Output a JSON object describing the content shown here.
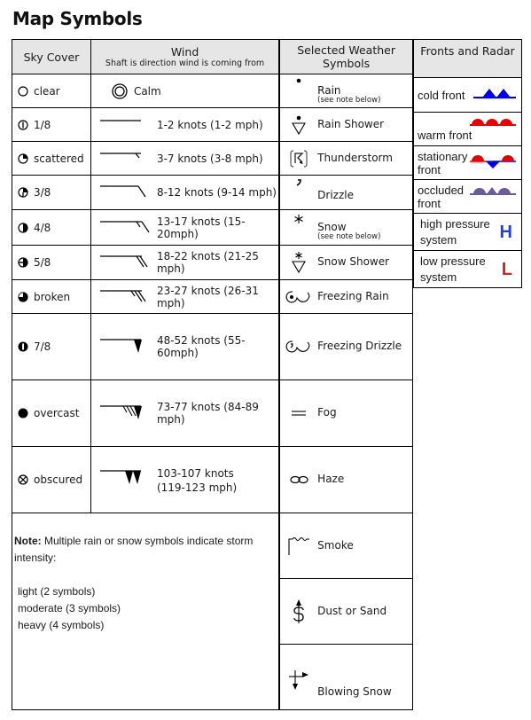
{
  "title": "Map Symbols",
  "main_table": {
    "headers": {
      "sky": "Sky Cover",
      "wind": "Wind",
      "wind_sub": "Shaft is direction wind is coming from",
      "weather": "Selected Weather",
      "weather2": "Symbols"
    },
    "rows": [
      {
        "sky_icon": "clear-circle",
        "sky": "clear",
        "wind_icon": "calm-double-circle",
        "wind": "Calm",
        "wx_icon": "rain-dot",
        "wx": "Rain",
        "wx_sub": "(see note below)"
      },
      {
        "sky_icon": "one-eighth-circle",
        "sky": "1/8",
        "wind_icon": "shaft-no-barb",
        "wind": "1-2 knots (1-2 mph)",
        "wx_icon": "rain-shower",
        "wx": "Rain Shower"
      },
      {
        "sky_icon": "scattered-circle",
        "sky": "scattered",
        "wind_icon": "shaft-half-barb",
        "wind": "3-7 knots (3-8 mph)",
        "wx_icon": "thunderstorm",
        "wx": "Thunderstorm"
      },
      {
        "sky_icon": "three-eighths-circle",
        "sky": "3/8",
        "wind_icon": "shaft-one-barb",
        "wind": "8-12 knots (9-14 mph)",
        "wx_icon": "drizzle-comma",
        "wx": "Drizzle"
      },
      {
        "sky_icon": "half-circle",
        "sky": "4/8",
        "wind_icon": "shaft-one-half-barb",
        "wind": "13-17 knots (15-20mph)",
        "wx_icon": "snow-asterisk",
        "wx": "Snow",
        "wx_sub": "(see note below)"
      },
      {
        "sky_icon": "five-eighths-circle",
        "sky": "5/8",
        "wind_icon": "shaft-two-barbs",
        "wind": "18-22 knots (21-25 mph)",
        "wx_icon": "snow-shower",
        "wx": "Snow Shower"
      },
      {
        "sky_icon": "broken-circle",
        "sky": "broken",
        "wind_icon": "shaft-two-half-barbs",
        "wind": "23-27 knots (26-31 mph)",
        "wx_icon": "freezing-rain",
        "wx": "Freezing Rain"
      },
      {
        "sky_icon": "seven-eighths-circle",
        "sky": "7/8",
        "wind_icon": "shaft-pennant",
        "wind": "48-52 knots (55-60mph)",
        "wx_icon": "freezing-drizzle",
        "wx": "Freezing Drizzle"
      },
      {
        "sky_icon": "overcast-circle",
        "sky": "overcast",
        "wind_icon": "shaft-pennant-barbs",
        "wind": "73-77 knots (84-89 mph)",
        "wx_icon": "fog-lines",
        "wx": "Fog"
      },
      {
        "sky_icon": "obscured-circle",
        "sky": "obscured",
        "wind_icon": "shaft-two-pennants",
        "wind": "103-107 knots",
        "wind2": "(119-123 mph)",
        "wx_icon": "haze-infinity",
        "wx": "Haze"
      }
    ],
    "note": {
      "bold": "Note:",
      "text": " Multiple rain or snow symbols indicate storm intensity:",
      "levels": [
        "light (2 symbols)",
        "moderate (3 symbols)",
        "heavy (4 symbols)"
      ]
    },
    "extra_wx": [
      {
        "wx_icon": "smoke",
        "wx": "Smoke"
      },
      {
        "wx_icon": "dust-sand",
        "wx": "Dust or Sand"
      },
      {
        "wx_icon": "blowing-snow",
        "wx": "Blowing Snow"
      }
    ]
  },
  "side_table": {
    "header": "Fronts and Radar",
    "rows": [
      {
        "label": "cold front",
        "icon": "cold-front",
        "color": "#0000ee"
      },
      {
        "label": "warm front",
        "icon": "warm-front",
        "color": "#ee0000"
      },
      {
        "label": "stationary",
        "label2": "front",
        "icon": "stationary-front"
      },
      {
        "label": "occluded",
        "label2": "front",
        "icon": "occluded-front",
        "color": "#6a5a9e"
      },
      {
        "label": "high pressure",
        "label2": "system",
        "letter": "H",
        "color": "#2244cc"
      },
      {
        "label": "low pressure",
        "label2": "system",
        "letter": "L",
        "color": "#e02020"
      }
    ]
  }
}
